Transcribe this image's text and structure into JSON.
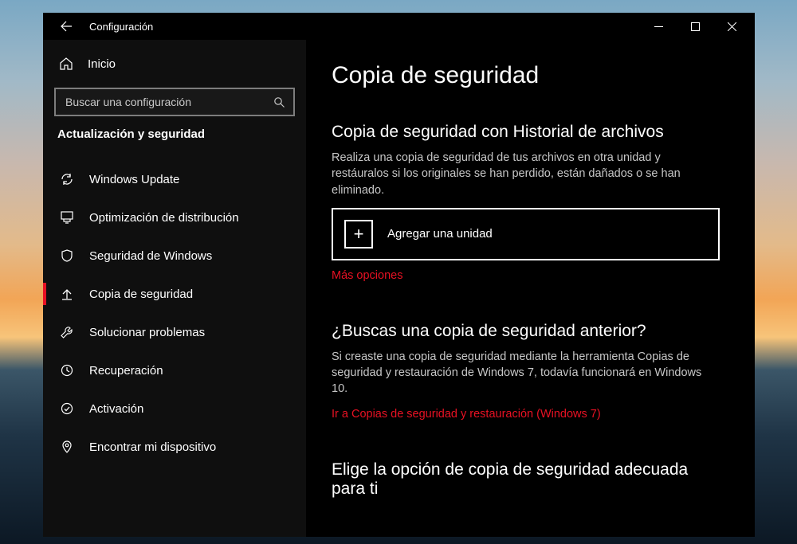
{
  "titlebar": {
    "title": "Configuración"
  },
  "sidebar": {
    "home_label": "Inicio",
    "search_placeholder": "Buscar una configuración",
    "category": "Actualización y seguridad",
    "items": [
      {
        "label": "Windows Update",
        "icon": "sync"
      },
      {
        "label": "Optimización de distribución",
        "icon": "delivery"
      },
      {
        "label": "Seguridad de Windows",
        "icon": "shield"
      },
      {
        "label": "Copia de seguridad",
        "icon": "backup",
        "active": true
      },
      {
        "label": "Solucionar problemas",
        "icon": "troubleshoot"
      },
      {
        "label": "Recuperación",
        "icon": "recovery"
      },
      {
        "label": "Activación",
        "icon": "activation"
      },
      {
        "label": "Encontrar mi dispositivo",
        "icon": "findmydevice"
      }
    ]
  },
  "main": {
    "heading": "Copia de seguridad",
    "sec1": {
      "title": "Copia de seguridad con Historial de archivos",
      "desc": "Realiza una copia de seguridad de tus archivos en otra unidad y restáuralos si los originales se han perdido, están dañados o se han eliminado.",
      "add_label": "Agregar una unidad",
      "more_options": "Más opciones"
    },
    "sec2": {
      "title": "¿Buscas una copia de seguridad anterior?",
      "desc": "Si creaste una copia de seguridad mediante la herramienta Copias de seguridad y restauración de Windows 7, todavía funcionará en Windows 10.",
      "link": "Ir a Copias de seguridad y restauración (Windows 7)"
    },
    "sec3": {
      "title": "Elige la opción de copia de seguridad adecuada para ti"
    }
  }
}
